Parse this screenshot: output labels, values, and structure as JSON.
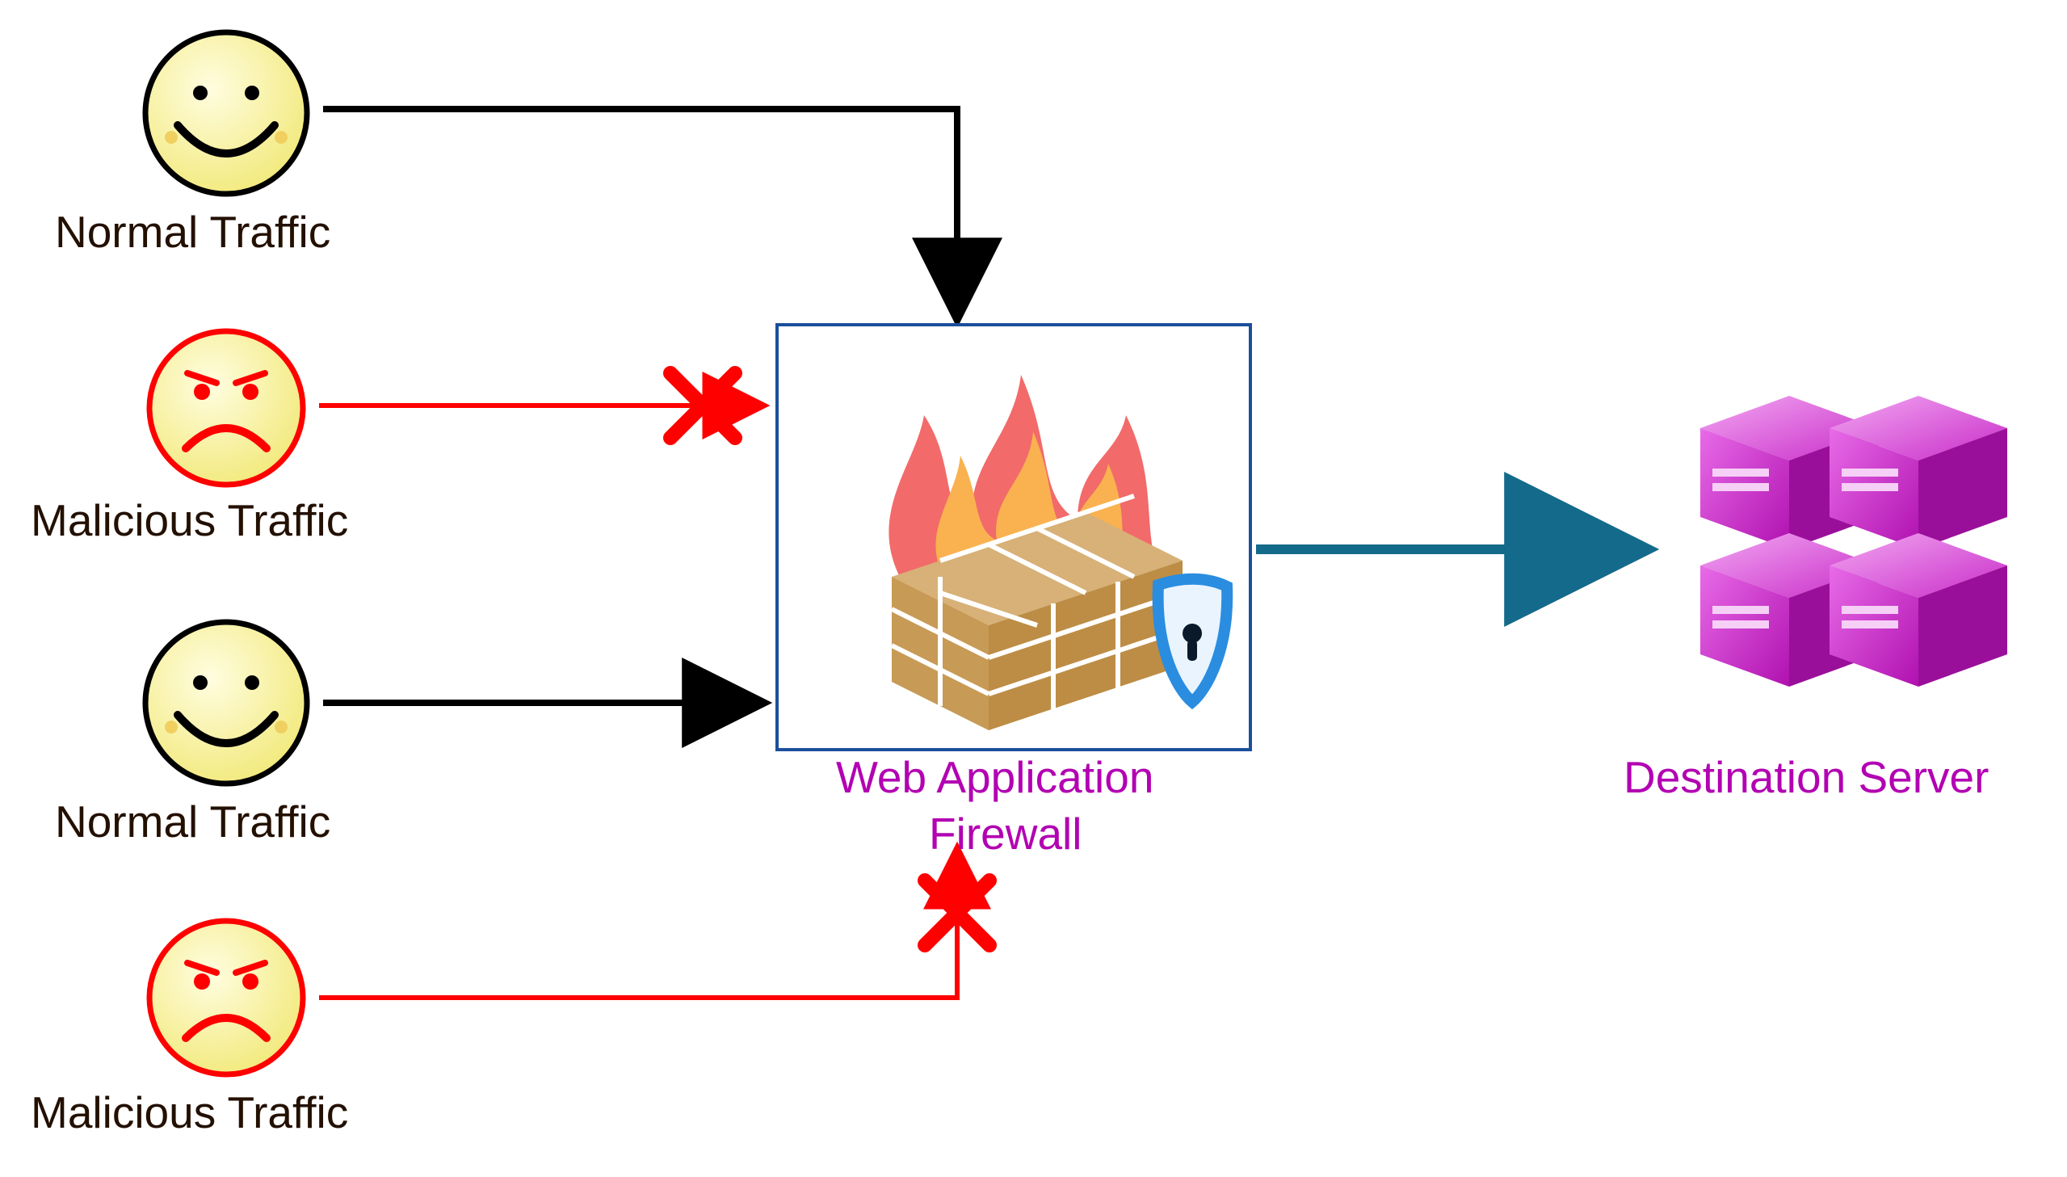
{
  "diagram": {
    "nodes": {
      "normal1": {
        "label": "Normal Traffic"
      },
      "malicious1": {
        "label": "Malicious Traffic"
      },
      "normal2": {
        "label": "Normal Traffic"
      },
      "malicious2": {
        "label": "Malicious Traffic"
      },
      "waf": {
        "label_line1": "Web Application",
        "label_line2": "Firewall"
      },
      "server": {
        "label": "Destination Server"
      }
    },
    "edges": [
      {
        "from": "normal1",
        "to": "waf",
        "blocked": false
      },
      {
        "from": "malicious1",
        "to": "waf",
        "blocked": true
      },
      {
        "from": "normal2",
        "to": "waf",
        "blocked": false
      },
      {
        "from": "malicious2",
        "to": "waf",
        "blocked": true
      },
      {
        "from": "waf",
        "to": "server",
        "blocked": false
      }
    ],
    "legend": {
      "blocked_marker": "X",
      "allowed_marker": "arrow"
    }
  }
}
